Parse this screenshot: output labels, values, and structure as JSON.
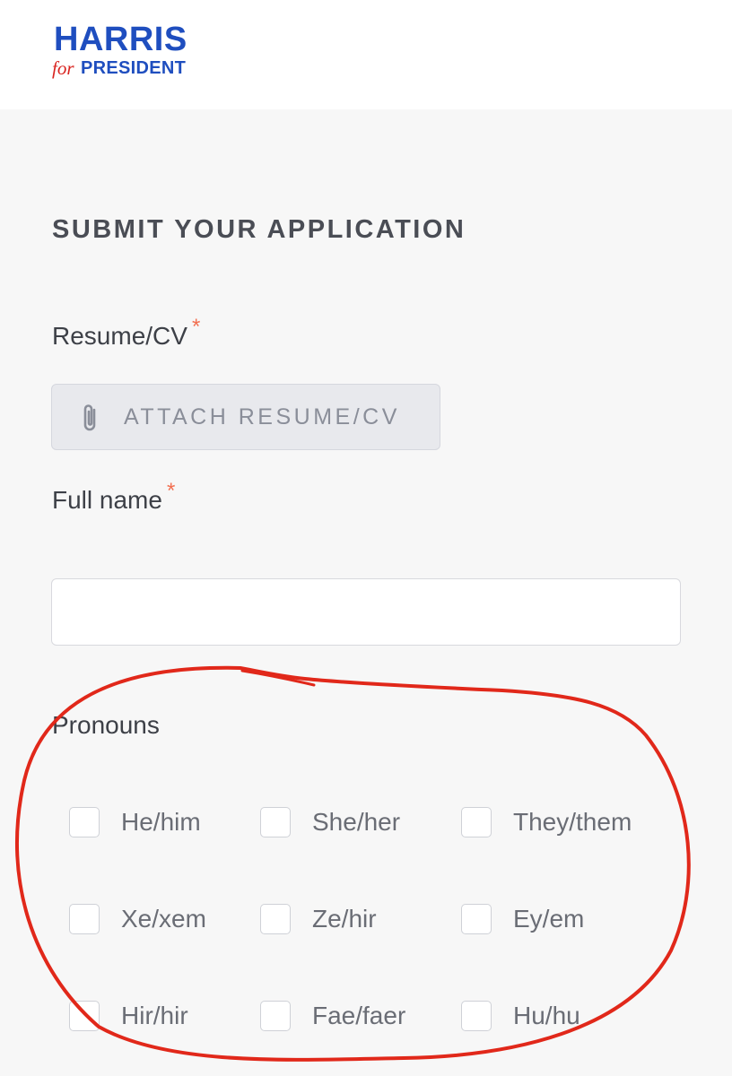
{
  "brand": {
    "name": "HARRIS",
    "for": "for",
    "office": "PRESIDENT"
  },
  "form": {
    "title": "SUBMIT YOUR APPLICATION",
    "resume": {
      "label": "Resume/CV",
      "required_mark": "*",
      "button_label": "ATTACH RESUME/CV",
      "icon": "paperclip-icon"
    },
    "full_name": {
      "label": "Full name",
      "required_mark": "*",
      "value": ""
    },
    "pronouns": {
      "label": "Pronouns",
      "options": [
        {
          "label": "He/him",
          "checked": false
        },
        {
          "label": "She/her",
          "checked": false
        },
        {
          "label": "They/them",
          "checked": false
        },
        {
          "label": "Xe/xem",
          "checked": false
        },
        {
          "label": "Ze/hir",
          "checked": false
        },
        {
          "label": "Ey/em",
          "checked": false
        },
        {
          "label": "Hir/hir",
          "checked": false
        },
        {
          "label": "Fae/faer",
          "checked": false
        },
        {
          "label": "Hu/hu",
          "checked": false
        }
      ]
    }
  },
  "colors": {
    "brand_blue": "#1f4ebf",
    "brand_red": "#d9231f",
    "required_star": "#f26f50",
    "annotation_red": "#e1281a",
    "page_background": "#f7f7f7"
  }
}
